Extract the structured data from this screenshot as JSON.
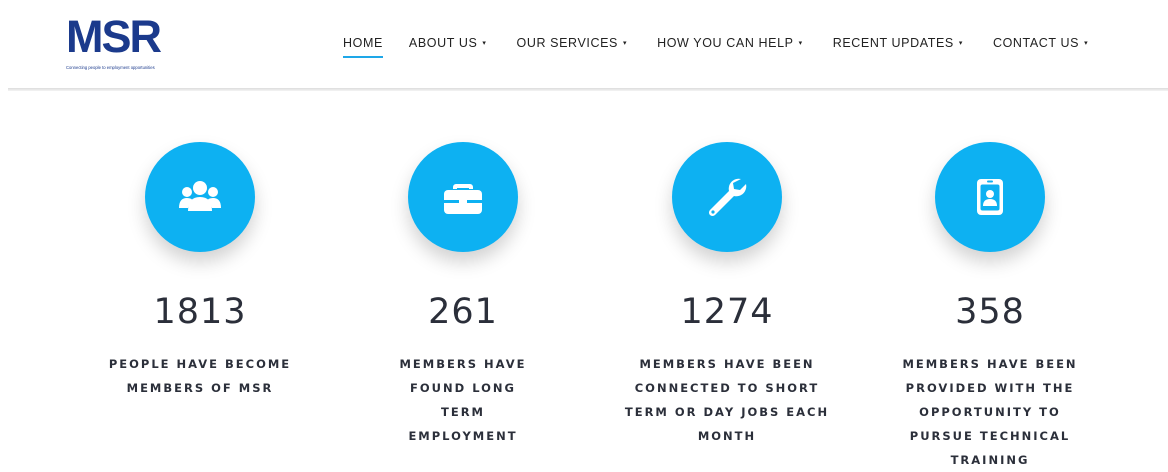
{
  "brand": {
    "logo_text": "MSR",
    "tagline": "Connecting people to employment opportunities",
    "colors": {
      "navy": "#1b3a8c",
      "accent": "#0db1f2",
      "underline": "#1ea7e8"
    }
  },
  "nav": {
    "items": [
      {
        "label": "HOME",
        "active": true,
        "dropdown": false
      },
      {
        "label": "ABOUT US",
        "active": false,
        "dropdown": true
      },
      {
        "label": "OUR SERVICES",
        "active": false,
        "dropdown": true
      },
      {
        "label": "HOW YOU CAN HELP",
        "active": false,
        "dropdown": true
      },
      {
        "label": "RECENT UPDATES",
        "active": false,
        "dropdown": true
      },
      {
        "label": "CONTACT US",
        "active": false,
        "dropdown": true
      }
    ],
    "caret": "▾"
  },
  "stats": [
    {
      "icon": "users-icon",
      "count": "1813",
      "desc": "PEOPLE HAVE BECOME MEMBERS OF MSR"
    },
    {
      "icon": "briefcase-icon",
      "count": "261",
      "desc": "MEMBERS HAVE FOUND LONG TERM EMPLOYMENT"
    },
    {
      "icon": "wrench-icon",
      "count": "1274",
      "desc": "MEMBERS HAVE BEEN CONNECTED TO SHORT TERM OR DAY JOBS EACH MONTH"
    },
    {
      "icon": "id-badge-icon",
      "count": "358",
      "desc": "MEMBERS HAVE BEEN PROVIDED WITH THE OPPORTUNITY TO PURSUE TECHNICAL TRAINING"
    }
  ]
}
